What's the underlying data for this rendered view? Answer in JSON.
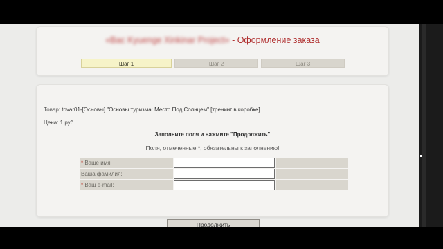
{
  "header": {
    "title_blurred": "«Bac Kyuenge Xinkinar Project»",
    "title_suffix": " - Оформление заказа"
  },
  "steps": [
    {
      "label": "Шаг 1",
      "active": true
    },
    {
      "label": "Шаг 2",
      "active": false
    },
    {
      "label": "Шаг 3",
      "active": false
    }
  ],
  "product": {
    "label": "Товар: ",
    "value": "tovar01-[Основы] \"Основы туризма: Место Под Солнцем\" [тренинг в коробке]"
  },
  "price": "Цена: 1 руб",
  "form": {
    "heading": "Заполните поля и нажмите \"Продолжить\"",
    "note": "Поля, отмеченные *, обязательны к заполнению!",
    "fields": [
      {
        "label": " Ваше имя:",
        "required": true,
        "value": ""
      },
      {
        "label": "  Ваша фамилия:",
        "required": false,
        "value": ""
      },
      {
        "label": " Ваш e-mail:",
        "required": true,
        "value": ""
      }
    ],
    "submit_label": "Продолжить"
  }
}
